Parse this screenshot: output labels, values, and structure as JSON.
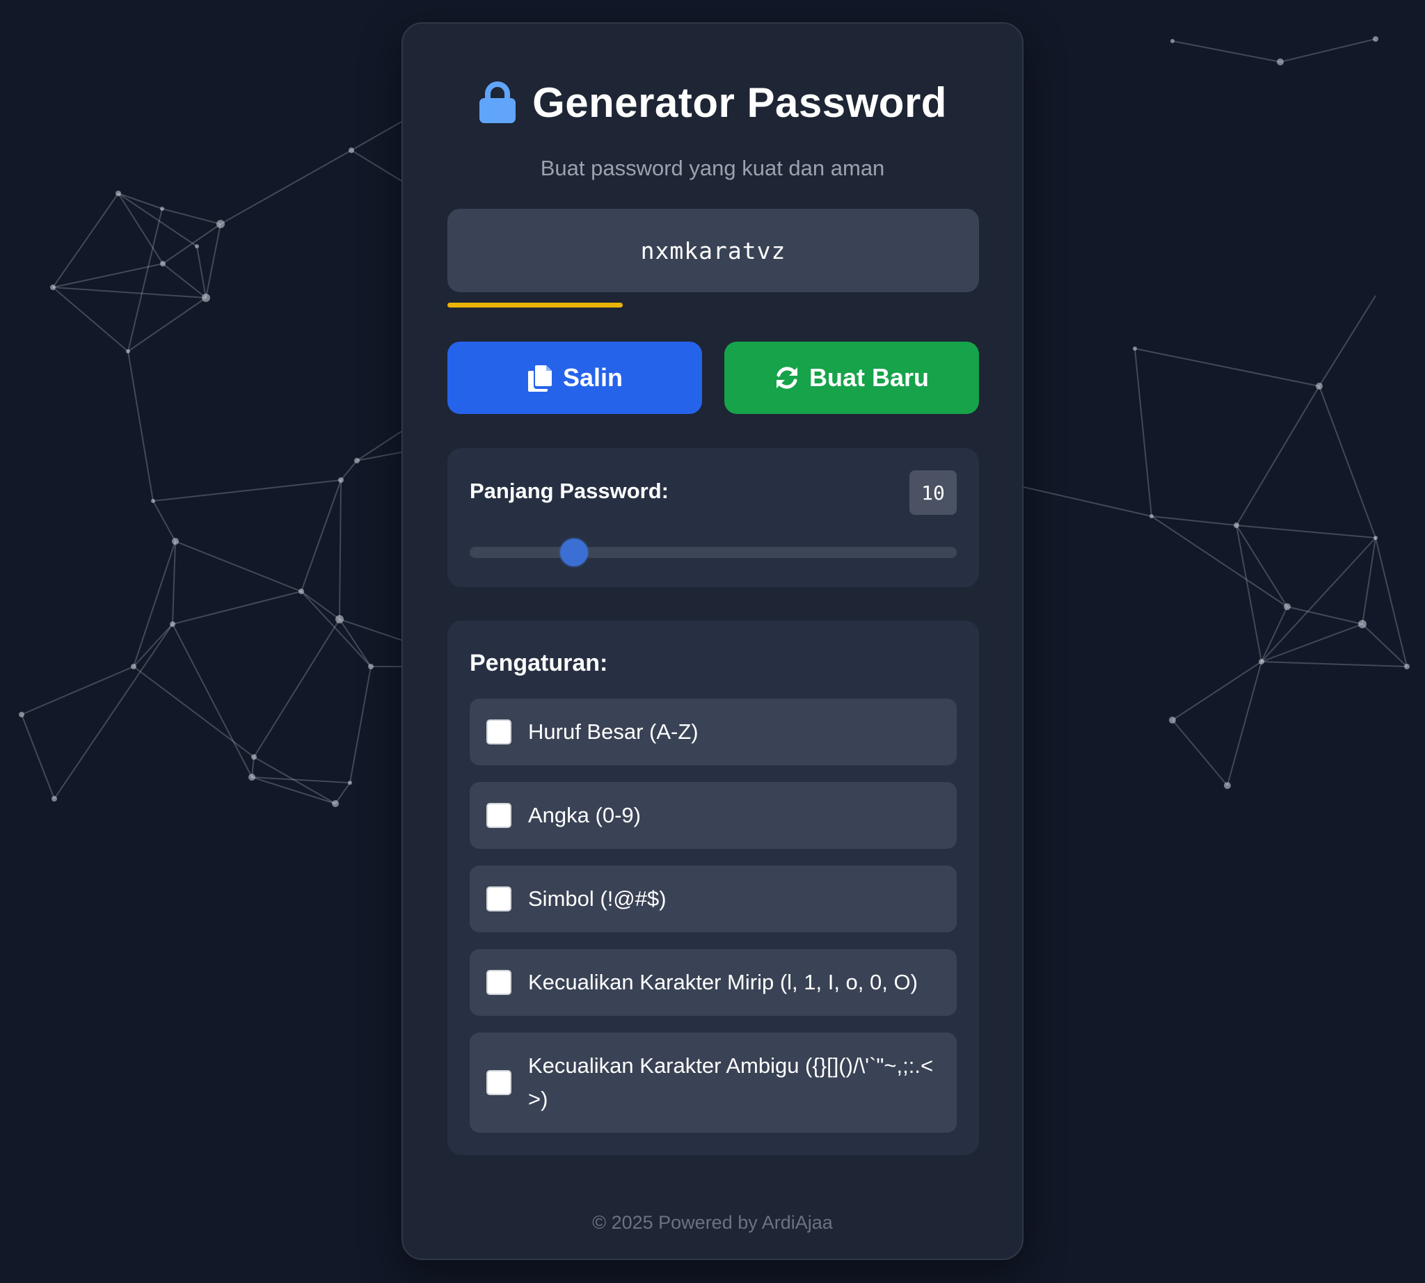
{
  "header": {
    "icon": "lock-icon",
    "title": "Generator Password",
    "subtitle": "Buat password yang kuat dan aman"
  },
  "password": {
    "value": "nxmkaratvz",
    "strength_fraction": 0.33,
    "strength_color": "#eab308"
  },
  "actions": {
    "copy_label": "Salin",
    "copy_icon": "copy-icon",
    "copy_color": "#2563eb",
    "new_label": "Buat Baru",
    "new_icon": "refresh-icon",
    "new_color": "#16a34a"
  },
  "length": {
    "label": "Panjang Password:",
    "value": "10",
    "min": 4,
    "max": 32,
    "current": 10
  },
  "settings": {
    "title": "Pengaturan:",
    "options": [
      {
        "label": "Huruf Besar (A-Z)",
        "checked": false
      },
      {
        "label": "Angka (0-9)",
        "checked": false
      },
      {
        "label": "Simbol (!@#$)",
        "checked": false
      },
      {
        "label": "Kecualikan Karakter Mirip (l, 1, I, o, 0, O)",
        "checked": false
      },
      {
        "label": "Kecualikan Karakter Ambigu ({}[]()/\\'`\"~,;:.<>)",
        "checked": false
      }
    ]
  },
  "footer": {
    "text": "© 2025 Powered by ArdiAjaa"
  }
}
